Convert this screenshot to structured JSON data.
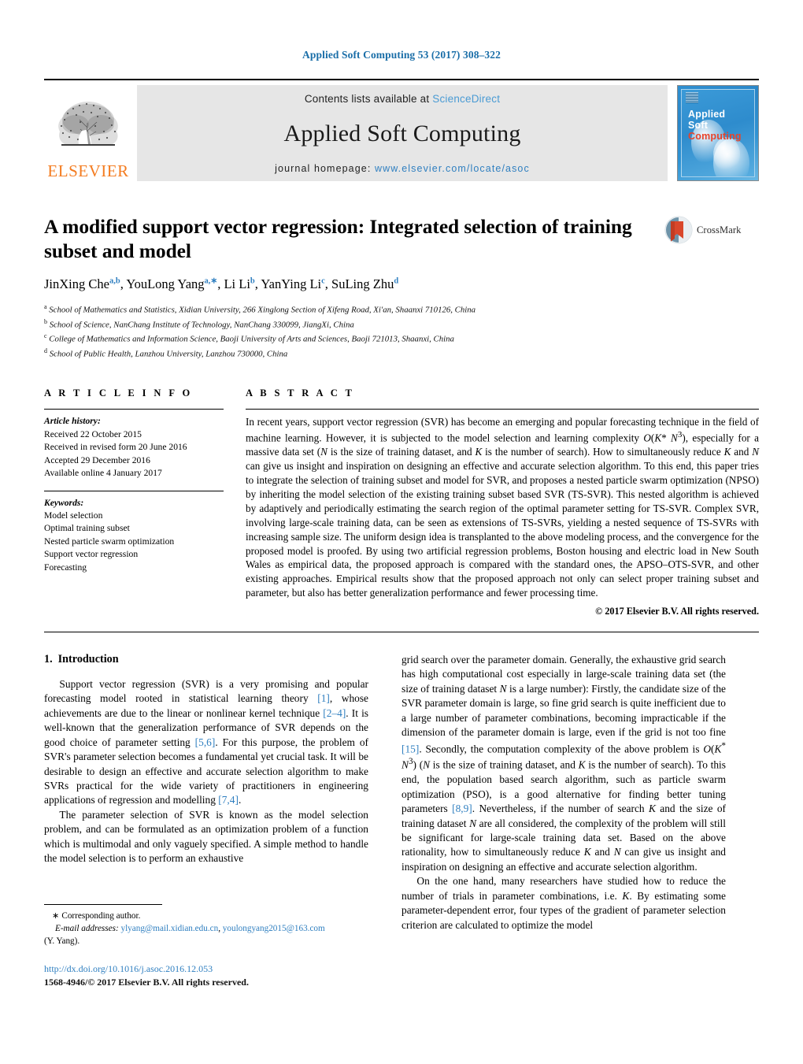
{
  "running_head": "Applied Soft Computing 53 (2017) 308–322",
  "masthead": {
    "publisher": "ELSEVIER",
    "contents_prefix": "Contents lists available at ",
    "contents_link": "ScienceDirect",
    "journal_title": "Applied Soft Computing",
    "homepage_label": "journal homepage: ",
    "homepage_url": "www.elsevier.com/locate/asoc",
    "cover": {
      "line1": "Applied",
      "line2": "Soft",
      "line3": "Computing",
      "accent_color": "#e8432a",
      "background_color": "#2f8fd0"
    }
  },
  "article": {
    "title": "A modified support vector regression: Integrated selection of training subset and model",
    "crossmark_label": "CrossMark",
    "authors_html": "JinXing Che<sup>a,b</sup>, YouLong Yang<sup>a,∗</sup>, Li Li<sup>b</sup>, YanYing Li<sup>c</sup>, SuLing Zhu<sup>d</sup>",
    "affiliations": [
      {
        "mark": "a",
        "text": "School of Mathematics and Statistics, Xidian University, 266 Xinglong Section of Xifeng Road, Xi'an, Shaanxi 710126, China"
      },
      {
        "mark": "b",
        "text": "School of Science, NanChang Institute of Technology, NanChang 330099, JiangXi, China"
      },
      {
        "mark": "c",
        "text": "College of Mathematics and Information Science, Baoji University of Arts and Sciences, Baoji 721013, Shaanxi, China"
      },
      {
        "mark": "d",
        "text": "School of Public Health, Lanzhou University, Lanzhou 730000, China"
      }
    ]
  },
  "article_info": {
    "heading": "A R T I C L E   I N F O",
    "history_label": "Article history:",
    "history": [
      "Received 22 October 2015",
      "Received in revised form 20 June 2016",
      "Accepted 29 December 2016",
      "Available online 4 January 2017"
    ],
    "keywords_label": "Keywords:",
    "keywords": [
      "Model selection",
      "Optimal training subset",
      "Nested particle swarm optimization",
      "Support vector regression",
      "Forecasting"
    ]
  },
  "abstract": {
    "heading": "A B S T R A C T",
    "paragraph_html": "In recent years, support vector regression (SVR) has become an emerging and popular forecasting technique in the field of machine learning. However, it is subjected to the model selection and learning complexity <i>O</i>(<i>K</i>* <i>N</i><sup>3</sup>), especially for a massive data set (<i>N</i> is the size of training dataset, and <i>K</i> is the number of search). How to simultaneously reduce <i>K</i> and <i>N</i> can give us insight and inspiration on designing an effective and accurate selection algorithm. To this end, this paper tries to integrate the selection of training subset and model for SVR, and proposes a nested particle swarm optimization (NPSO) by inheriting the model selection of the existing training subset based SVR (TS-SVR). This nested algorithm is achieved by adaptively and periodically estimating the search region of the optimal parameter setting for TS-SVR. Complex SVR, involving large-scale training data, can be seen as extensions of TS-SVRs, yielding a nested sequence of TS-SVRs with increasing sample size. The uniform design idea is transplanted to the above modeling process, and the convergence for the proposed model is proofed. By using two artificial regression problems, Boston housing and electric load in New South Wales as empirical data, the proposed approach is compared with the standard ones, the APSO–OTS-SVR, and other existing approaches. Empirical results show that the proposed approach not only can select proper training subset and parameter, but also has better generalization performance and fewer processing time.",
    "copyright": "© 2017 Elsevier B.V. All rights reserved."
  },
  "introduction": {
    "number": "1.",
    "title": "Introduction",
    "left_paragraphs_html": [
      "Support vector regression (SVR) is a very promising and popular forecasting model rooted in statistical learning theory <span class=\"ref\">[1]</span>, whose achievements are due to the linear or nonlinear kernel technique <span class=\"ref\">[2–4]</span>. It is well-known that the generalization performance of SVR depends on the good choice of parameter setting <span class=\"ref\">[5,6]</span>. For this purpose, the problem of SVR's parameter selection becomes a fundamental yet crucial task. It will be desirable to design an effective and accurate selection algorithm to make SVRs practical for the wide variety of practitioners in engineering applications of regression and modelling <span class=\"ref\">[7,4]</span>.",
      "The parameter selection of SVR is known as the model selection problem, and can be formulated as an optimization problem of a function which is multimodal and only vaguely specified. A simple method to handle the model selection is to perform an exhaustive"
    ],
    "right_paragraphs_html": [
      "grid search over the parameter domain. Generally, the exhaustive grid search has high computational cost especially in large-scale training data set (the size of training dataset <i>N</i> is a large number): Firstly, the candidate size of the SVR parameter domain is large, so fine grid search is quite inefficient due to a large number of parameter combinations, becoming impracticable if the dimension of the parameter domain is large, even if the grid is not too fine <span class=\"ref\">[15]</span>. Secondly, the computation complexity of the above problem is <i>O</i>(<i>K</i><sup>*</sup> <i>N</i><sup>3</sup>) (<i>N</i> is the size of training dataset, and <i>K</i> is the number of search). To this end, the population based search algorithm, such as particle swarm optimization (PSO), is a good alternative for finding better tuning parameters <span class=\"ref\">[8,9]</span>. Nevertheless, if the number of search <i>K</i> and the size of training dataset <i>N</i> are all considered, the complexity of the problem will still be significant for large-scale training data set. Based on the above rationality, how to simultaneously reduce <i>K</i> and <i>N</i> can give us insight and inspiration on designing an effective and accurate selection algorithm.",
      "On the one hand, many researchers have studied how to reduce the number of trials in parameter combinations, i.e. <i>K</i>. By estimating some parameter-dependent error, four types of the gradient of parameter selection criterion are calculated to optimize the model"
    ]
  },
  "footnote": {
    "corresponding_marker": "∗",
    "corresponding_text": "Corresponding author.",
    "email_label": "E-mail addresses:",
    "emails": [
      "ylyang@mail.xidian.edu.cn",
      "youlongyang2015@163.com"
    ],
    "attribution": "(Y. Yang)."
  },
  "doi_block": {
    "doi_url": "http://dx.doi.org/10.1016/j.asoc.2016.12.053",
    "issn_line": "1568-4946/© 2017 Elsevier B.V. All rights reserved."
  }
}
